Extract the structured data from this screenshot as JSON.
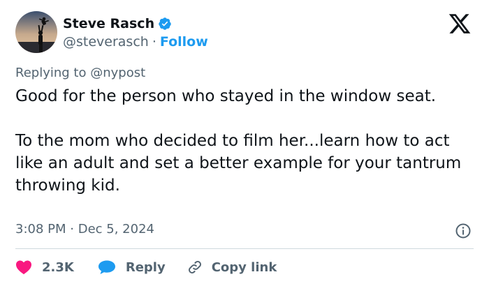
{
  "author": {
    "display_name": "Steve Rasch",
    "handle": "@steverasch",
    "separator": "·",
    "follow_label": "Follow",
    "verified": true
  },
  "reply_context": {
    "prefix": "Replying to",
    "target": "@nypost"
  },
  "tweet": {
    "paragraphs": [
      "Good for the person who stayed in the window seat.",
      "To the mom who decided to film her...learn how to act like an adult and set a better example for your tantrum throwing kid."
    ],
    "time": "3:08 PM",
    "separator": "·",
    "date": "Dec 5, 2024"
  },
  "actions": {
    "like_count": "2.3K",
    "reply_label": "Reply",
    "copy_link_label": "Copy link"
  },
  "colors": {
    "like": "#f91880",
    "reply": "#1d9bf0",
    "follow": "#1d9bf0",
    "verified": "#1d9bf0",
    "muted": "#536471",
    "text": "#0f1419"
  },
  "icons": {
    "platform": "x-logo-icon",
    "verified": "verified-badge-icon",
    "like": "heart-icon",
    "reply": "speech-bubble-icon",
    "copy": "link-icon",
    "info": "info-icon"
  }
}
